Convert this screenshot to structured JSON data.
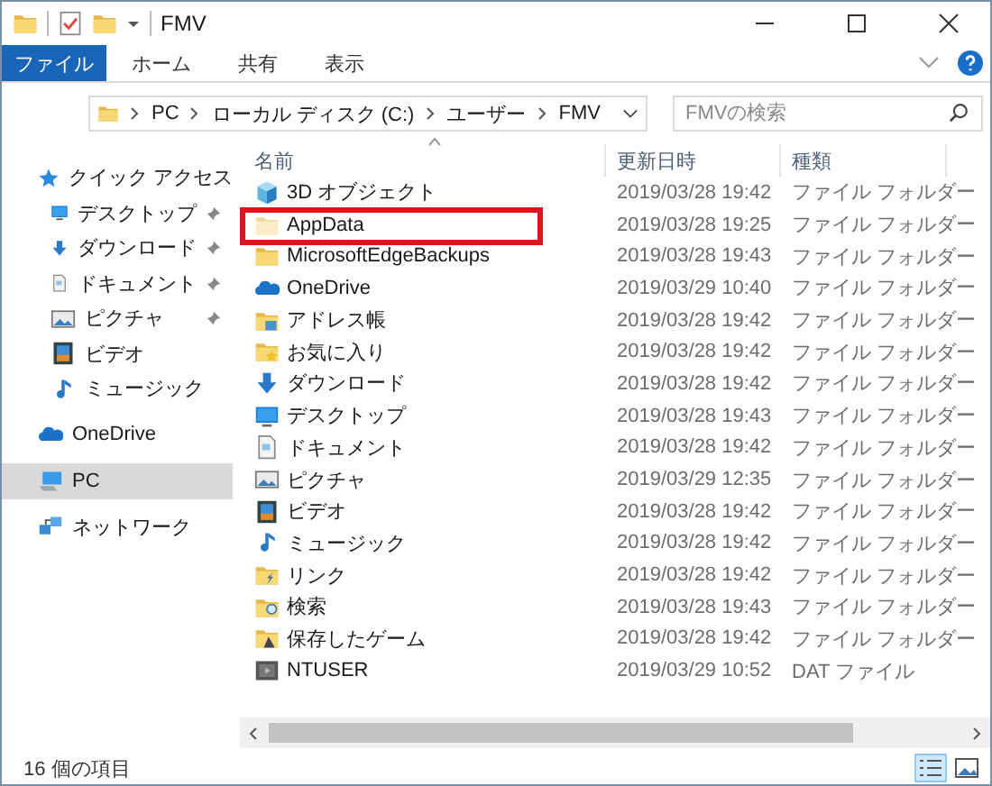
{
  "window": {
    "title": "FMV"
  },
  "ribbon": {
    "file_tab": "ファイル",
    "tabs": [
      {
        "label": "ホーム",
        "selected": false
      },
      {
        "label": "共有",
        "selected": false
      },
      {
        "label": "表示",
        "selected": false
      }
    ]
  },
  "address": {
    "path": [
      "PC",
      "ローカル ディスク (C:)",
      "ユーザー",
      "FMV"
    ]
  },
  "search": {
    "placeholder": "FMVの検索"
  },
  "sidebar": {
    "items": [
      {
        "label": "クイック アクセス",
        "kind": "star",
        "selected": false,
        "children": [
          {
            "label": "デスクトップ",
            "kind": "desktop",
            "pinned": true,
            "selected": false
          },
          {
            "label": "ダウンロード",
            "kind": "download",
            "pinned": true,
            "selected": false
          },
          {
            "label": "ドキュメント",
            "kind": "document",
            "pinned": true,
            "selected": false
          },
          {
            "label": "ピクチャ",
            "kind": "picture",
            "pinned": true,
            "selected": false
          },
          {
            "label": "ビデオ",
            "kind": "video",
            "pinned": false,
            "selected": false
          },
          {
            "label": "ミュージック",
            "kind": "music",
            "pinned": false,
            "selected": false
          }
        ]
      },
      {
        "label": "OneDrive",
        "kind": "onedrive",
        "selected": false
      },
      {
        "label": "PC",
        "kind": "pc",
        "selected": true
      },
      {
        "label": "ネットワーク",
        "kind": "network",
        "selected": false
      }
    ]
  },
  "table": {
    "columns": [
      "名前",
      "更新日時",
      "種類"
    ],
    "rows": [
      {
        "name": "3D オブジェクト",
        "kind": "cube",
        "date": "2019/03/28 19:42",
        "type": "ファイル フォルダー",
        "highlighted": false
      },
      {
        "name": "AppData",
        "kind": "folder-pale",
        "date": "2019/03/28 19:25",
        "type": "ファイル フォルダー",
        "highlighted": true
      },
      {
        "name": "MicrosoftEdgeBackups",
        "kind": "folder",
        "date": "2019/03/28 19:43",
        "type": "ファイル フォルダー",
        "highlighted": false
      },
      {
        "name": "OneDrive",
        "kind": "onedrive",
        "date": "2019/03/29 10:40",
        "type": "ファイル フォルダー",
        "highlighted": false
      },
      {
        "name": "アドレス帳",
        "kind": "contacts",
        "date": "2019/03/28 19:42",
        "type": "ファイル フォルダー",
        "highlighted": false
      },
      {
        "name": "お気に入り",
        "kind": "favorites",
        "date": "2019/03/28 19:42",
        "type": "ファイル フォルダー",
        "highlighted": false
      },
      {
        "name": "ダウンロード",
        "kind": "download",
        "date": "2019/03/28 19:42",
        "type": "ファイル フォルダー",
        "highlighted": false
      },
      {
        "name": "デスクトップ",
        "kind": "desktop",
        "date": "2019/03/28 19:43",
        "type": "ファイル フォルダー",
        "highlighted": false
      },
      {
        "name": "ドキュメント",
        "kind": "document",
        "date": "2019/03/28 19:42",
        "type": "ファイル フォルダー",
        "highlighted": false
      },
      {
        "name": "ピクチャ",
        "kind": "picture",
        "date": "2019/03/29 12:35",
        "type": "ファイル フォルダー",
        "highlighted": false
      },
      {
        "name": "ビデオ",
        "kind": "video",
        "date": "2019/03/28 19:42",
        "type": "ファイル フォルダー",
        "highlighted": false
      },
      {
        "name": "ミュージック",
        "kind": "music",
        "date": "2019/03/28 19:42",
        "type": "ファイル フォルダー",
        "highlighted": false
      },
      {
        "name": "リンク",
        "kind": "links",
        "date": "2019/03/28 19:42",
        "type": "ファイル フォルダー",
        "highlighted": false
      },
      {
        "name": "検索",
        "kind": "searches",
        "date": "2019/03/28 19:43",
        "type": "ファイル フォルダー",
        "highlighted": false
      },
      {
        "name": "保存したゲーム",
        "kind": "games",
        "date": "2019/03/28 19:42",
        "type": "ファイル フォルダー",
        "highlighted": false
      },
      {
        "name": "NTUSER",
        "kind": "file",
        "date": "2019/03/29 10:52",
        "type": "DAT ファイル",
        "highlighted": false
      }
    ]
  },
  "status_bar": {
    "item_count": "16 個の項目",
    "views": [
      {
        "kind": "details",
        "selected": true
      },
      {
        "kind": "large",
        "selected": false
      }
    ]
  }
}
